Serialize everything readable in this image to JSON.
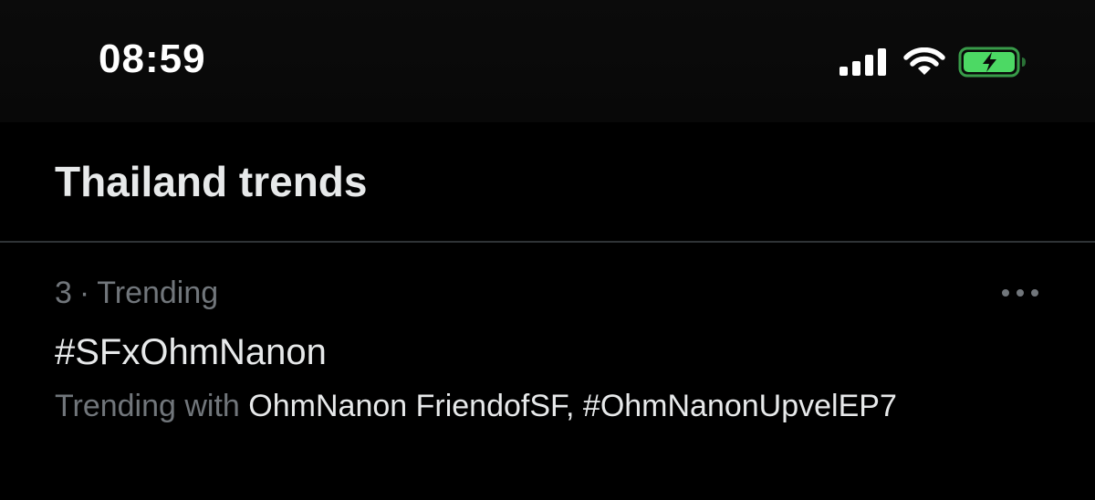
{
  "status_bar": {
    "time": "08:59",
    "icons": [
      "cellular-signal-icon",
      "wifi-icon",
      "battery-charging-icon"
    ],
    "battery_color": "#4cd964"
  },
  "header": {
    "title": "Thailand trends"
  },
  "trend": {
    "rank": "3",
    "separator": "·",
    "category": "Trending",
    "name": "#SFxOhmNanon",
    "with_prefix": "Trending with",
    "with_links": "OhmNanon FriendofSF, #OhmNanonUpvelEP7",
    "more_icon": "more-horizontal-icon"
  },
  "colors": {
    "background": "#000000",
    "primary_text": "#e7e9ea",
    "secondary_text": "#71767b",
    "divider": "#2f3336"
  }
}
